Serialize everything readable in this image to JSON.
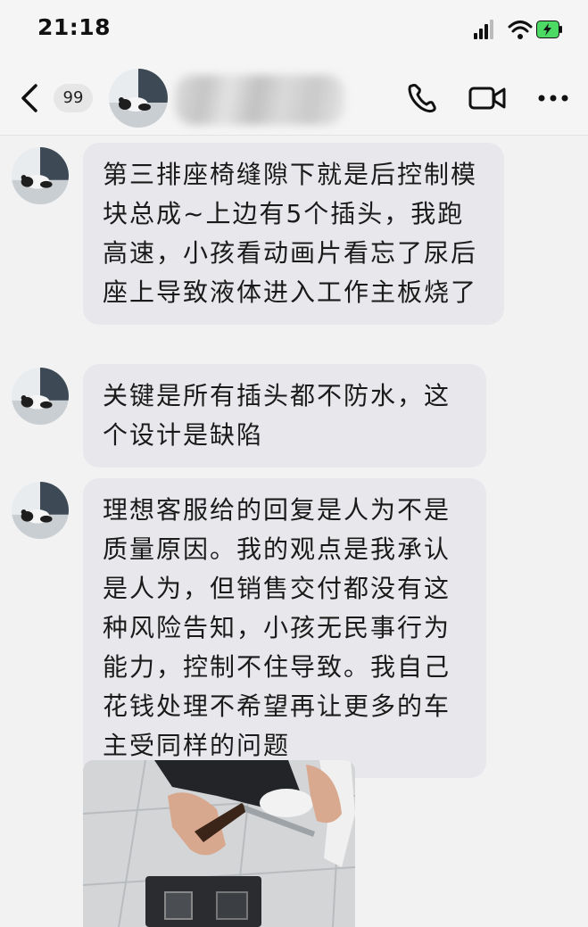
{
  "status_bar": {
    "time": "21:18",
    "icons": [
      "signal-icon",
      "wifi-icon",
      "battery-charging-icon"
    ],
    "battery_color": "#4cd964"
  },
  "nav": {
    "back_icon": "chevron-left-icon",
    "unread_count": "99",
    "contact_name": "",
    "actions": [
      "phone-icon",
      "video-camera-icon",
      "more-icon"
    ]
  },
  "messages": [
    {
      "sender": "contact",
      "type": "text",
      "text": "第三排座椅缝隙下就是后控制模块总成~上边有5个插头，我跑高速，小孩看动画片看忘了尿后座上导致液体进入工作主板烧了"
    },
    {
      "sender": "contact",
      "type": "text",
      "text": "关键是所有插头都不防水，这个设计是缺陷"
    },
    {
      "sender": "contact",
      "type": "text",
      "text": "理想客服给的回复是人为不是质量原因。我的观点是我承认是人为，但销售交付都没有这种风险告知，小孩无民事行为能力，控制不住导致。我自己花钱处理不希望再让更多的车主受同样的问题"
    },
    {
      "sender": "contact",
      "type": "image",
      "description_icon": "photo-image"
    }
  ],
  "colors": {
    "bubble": "#e8e8ec",
    "background": "#f2f2f2",
    "text": "#1a1a1a"
  }
}
